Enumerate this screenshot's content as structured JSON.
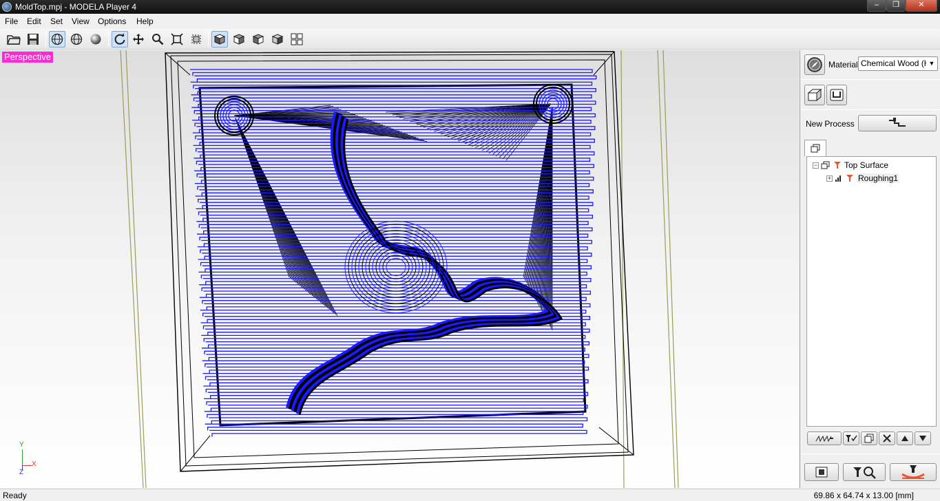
{
  "window": {
    "title": "MoldTop.mpj - MODELA Player 4",
    "minimize": "‒",
    "maximize": "❐",
    "close": "✕"
  },
  "menu": {
    "items": [
      "File",
      "Edit",
      "Set",
      "View",
      "Options",
      "Help"
    ]
  },
  "toolbar": {
    "buttons": [
      {
        "icon": "open-folder-icon"
      },
      {
        "icon": "save-icon"
      },
      {
        "icon": "wireframe-sphere-icon",
        "active": true
      },
      {
        "icon": "mesh-sphere-icon"
      },
      {
        "icon": "solid-sphere-icon"
      },
      {
        "icon": "rotate-icon",
        "active": true
      },
      {
        "icon": "pan-icon"
      },
      {
        "icon": "zoom-icon"
      },
      {
        "icon": "fit-view-icon"
      },
      {
        "icon": "zoom-box-icon"
      },
      {
        "icon": "view-cube-top-icon",
        "active": true
      },
      {
        "icon": "view-cube-front-icon"
      },
      {
        "icon": "view-cube-right-icon"
      },
      {
        "icon": "view-cube-iso-icon"
      },
      {
        "icon": "four-views-icon"
      }
    ]
  },
  "viewport": {
    "label": "Perspective",
    "label_color": "#ff2ad6",
    "toolpath_color": "#1a1aff",
    "axis": {
      "y": "Y",
      "x": "X",
      "z": "Z"
    }
  },
  "panel": {
    "material_label": "Material",
    "material_value": "Chemical Wood (Ha",
    "new_process_label": "New Process",
    "tree": [
      {
        "label": "Top Surface",
        "expander": "−"
      },
      {
        "label": "Roughing1",
        "expander": "+"
      }
    ]
  },
  "status": {
    "left": "Ready",
    "right": "69.86 x 64.74 x 13.00 [mm]"
  }
}
